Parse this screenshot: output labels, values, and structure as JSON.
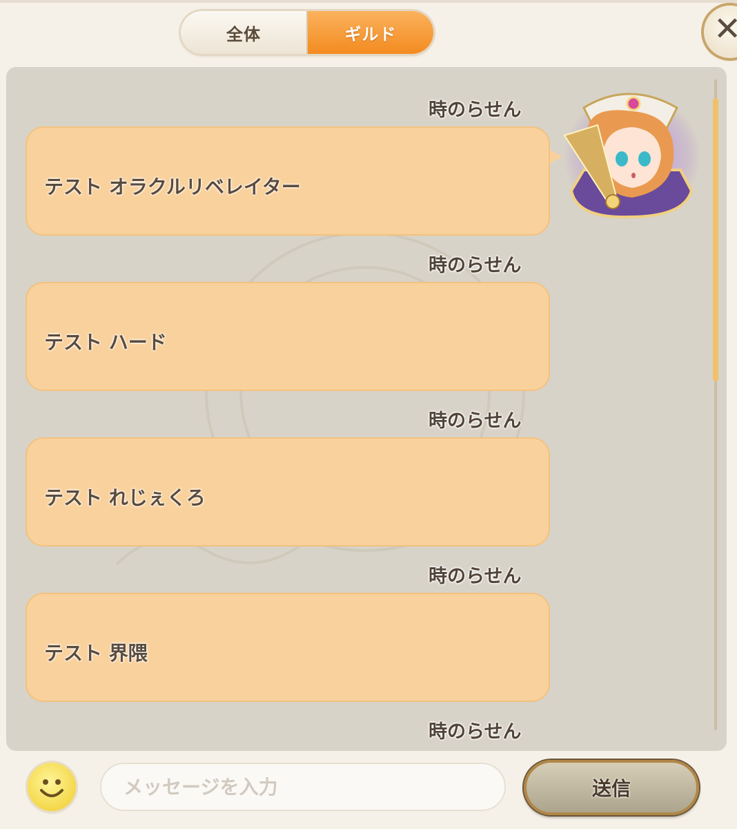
{
  "tabs": [
    {
      "label": "全体",
      "active": false
    },
    {
      "label": "ギルド",
      "active": true
    }
  ],
  "close_icon": "✕",
  "messages": [
    {
      "sender": "時のらせん",
      "text": "テスト オラクルリベレイター"
    },
    {
      "sender": "時のらせん",
      "text": "テスト ハード"
    },
    {
      "sender": "時のらせん",
      "text": "テスト れじぇくろ"
    },
    {
      "sender": "時のらせん",
      "text": "テスト 界隈"
    },
    {
      "sender": "時のらせん"
    }
  ],
  "input": {
    "placeholder": "メッセージを入力",
    "value": ""
  },
  "send_label": "送信",
  "icons": {
    "emoji": "smiley-face-icon",
    "close": "close-icon",
    "avatar": "character-avatar"
  },
  "colors": {
    "active_tab": "#f5972f",
    "bubble": "#f9d19c",
    "panel": "#d8d3c8",
    "scrollbar": "#f1c16a"
  }
}
